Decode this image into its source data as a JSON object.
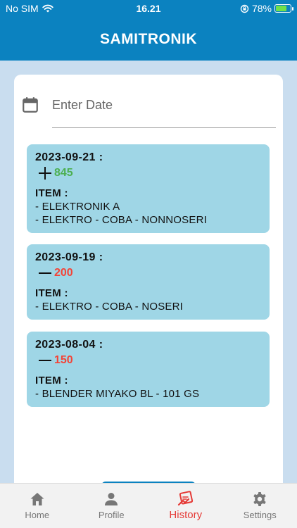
{
  "status_bar": {
    "carrier": "No SIM",
    "time": "16.21",
    "battery": "78%",
    "battery_level": 0.78
  },
  "app_bar": {
    "title": "SAMITRONIK"
  },
  "date_filter": {
    "placeholder": "Enter Date",
    "value": ""
  },
  "history": [
    {
      "date": "2023-09-21 :",
      "direction": "in",
      "amount": "845",
      "item_label": "ITEM :",
      "items": [
        "- ELEKTRONIK A",
        "- ELEKTRO - COBA - NONNOSERI"
      ]
    },
    {
      "date": "2023-09-19 :",
      "direction": "out",
      "amount": "200",
      "item_label": "ITEM :",
      "items": [
        "- ELEKTRO - COBA - NOSERI"
      ]
    },
    {
      "date": "2023-08-04 :",
      "direction": "out",
      "amount": "150",
      "item_label": "ITEM :",
      "items": [
        "- BLENDER MIYAKO BL - 101 GS"
      ]
    }
  ],
  "nav": {
    "home": "Home",
    "profile": "Profile",
    "history": "History",
    "settings": "Settings",
    "active": "history"
  },
  "colors": {
    "primary": "#0b82c0",
    "entry_bg": "#9fd6e6",
    "positive": "#4caf50",
    "negative": "#f44336",
    "active_nav": "#e53935"
  }
}
